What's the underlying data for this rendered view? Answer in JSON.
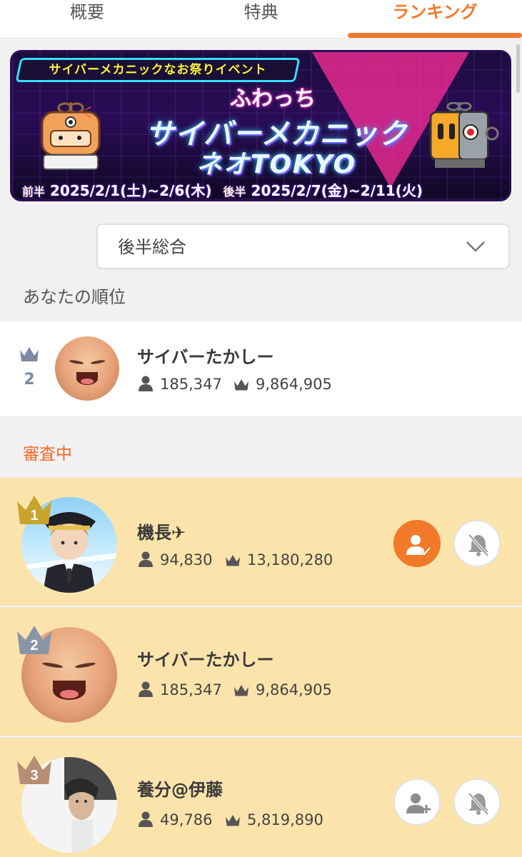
{
  "tabs": [
    {
      "label": "概要"
    },
    {
      "label": "特典"
    },
    {
      "label": "ランキング"
    }
  ],
  "active_tab": 2,
  "banner": {
    "event_bar": "サイバーメカニックなお祭りイベント",
    "brand": "ふわっち",
    "title_line1": "サイバーメカニック",
    "title_line2": "ネオTOKYO",
    "first_half_label": "前半",
    "first_half_dates": "2025/2/1(土)~2/6(木)",
    "second_half_label": "後半",
    "second_half_dates": "2025/2/7(金)~2/11(火)"
  },
  "filter": {
    "selected": "後半総合"
  },
  "my_rank": {
    "section_label": "あなたの順位",
    "rank": "2",
    "name": "サイバーたかしー",
    "followers": "185,347",
    "points": "9,864,905"
  },
  "review_label": "審査中",
  "ranking": [
    {
      "rank": "1",
      "name": "機長✈",
      "followers": "94,830",
      "points": "13,180,280",
      "following": true,
      "badge_color": "#c9a42c"
    },
    {
      "rank": "2",
      "name": "サイバーたかしー",
      "followers": "185,347",
      "points": "9,864,905",
      "following": null,
      "badge_color": "#8a95a8"
    },
    {
      "rank": "3",
      "name": "養分@伊藤",
      "followers": "49,786",
      "points": "5,819,890",
      "following": false,
      "badge_color": "#b58e74"
    }
  ],
  "colors": {
    "accent": "#f07a2a",
    "row_bg": "#fbe4ab"
  }
}
